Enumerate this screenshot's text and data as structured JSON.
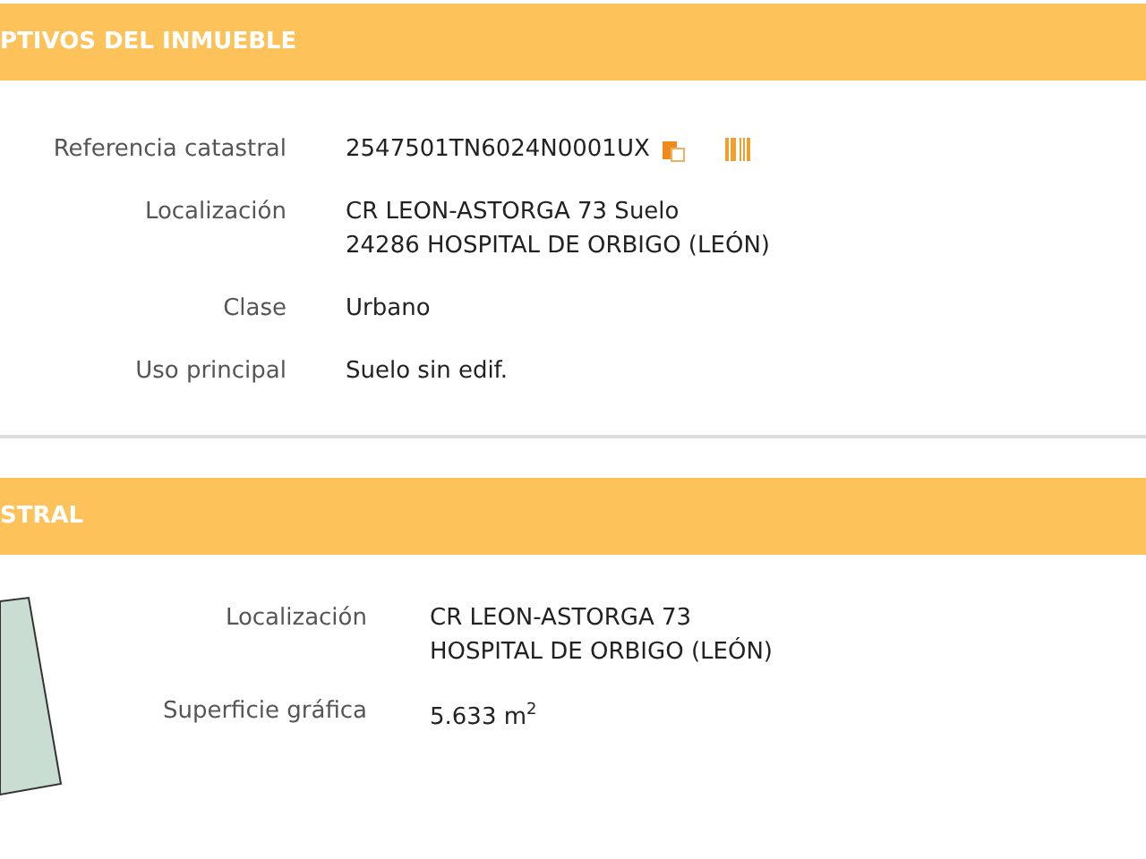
{
  "sections": [
    {
      "title": "PTIVOS DEL INMUEBLE",
      "kind": "data",
      "rows": [
        {
          "label": "Referencia catastral",
          "lines": [
            "2547501TN6024N0001UX"
          ],
          "actions": [
            {
              "kind": "copy"
            },
            {
              "kind": "barcode"
            }
          ]
        },
        {
          "label": "Localización",
          "lines": [
            "CR LEON-ASTORGA 73 Suelo",
            "24286 HOSPITAL DE ORBIGO (LEÓN)"
          ]
        },
        {
          "label": "Clase",
          "lines": [
            "Urbano"
          ]
        },
        {
          "label": "Uso principal",
          "lines": [
            "Suelo sin edif."
          ]
        }
      ]
    },
    {
      "title": "STRAL",
      "kind": "parcel",
      "rows": [
        {
          "label": "Localización",
          "lines": [
            "CR LEON-ASTORGA 73",
            "HOSPITAL DE ORBIGO (LEÓN)"
          ]
        },
        {
          "label": "Superficie gráfica",
          "lines": [
            "5.633 m$^{2}$"
          ]
        }
      ]
    }
  ]
}
